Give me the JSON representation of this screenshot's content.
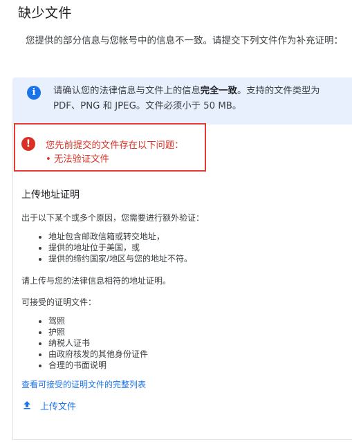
{
  "page": {
    "title": "缺少文件",
    "intro": "您提供的部分信息与您帐号中的信息不一致。请提交下列文件作为补充证明："
  },
  "info_banner": {
    "icon": "info-icon",
    "text_before": "请确认您的法律信息与文件上的信息",
    "text_bold": "完全一致",
    "text_after": "。支持的文件类型为 PDF、PNG 和 JPEG。文件必须小于 50 MB。"
  },
  "error_banner": {
    "icon": "error-icon",
    "title": "您先前提交的文件存在以下问题：",
    "items": [
      "• 无法验证文件"
    ],
    "highlight_color": "#e53935"
  },
  "address_section": {
    "title": "上传地址证明",
    "reason_intro": "出于以下某个或多个原因，您需要进行额外验证：",
    "reasons": [
      "地址包含邮政信箱或转交地址，",
      "提供的地址位于美国，或",
      "提供的缔约国家/地区与您的地址不符。"
    ],
    "upload_note": "请上传与您的法律信息相符的地址证明。",
    "accepted_title": "可接受的证明文件：",
    "accepted_docs": [
      "驾照",
      "护照",
      "纳税人证书",
      "由政府核发的其他身份证件",
      "合理的书面说明"
    ],
    "full_list_link": "查看可接受的证明文件的完整列表",
    "upload_button": "上传文件"
  },
  "colors": {
    "accent": "#1a73e8",
    "error": "#d93025",
    "info_bg": "#e8f0fe"
  }
}
